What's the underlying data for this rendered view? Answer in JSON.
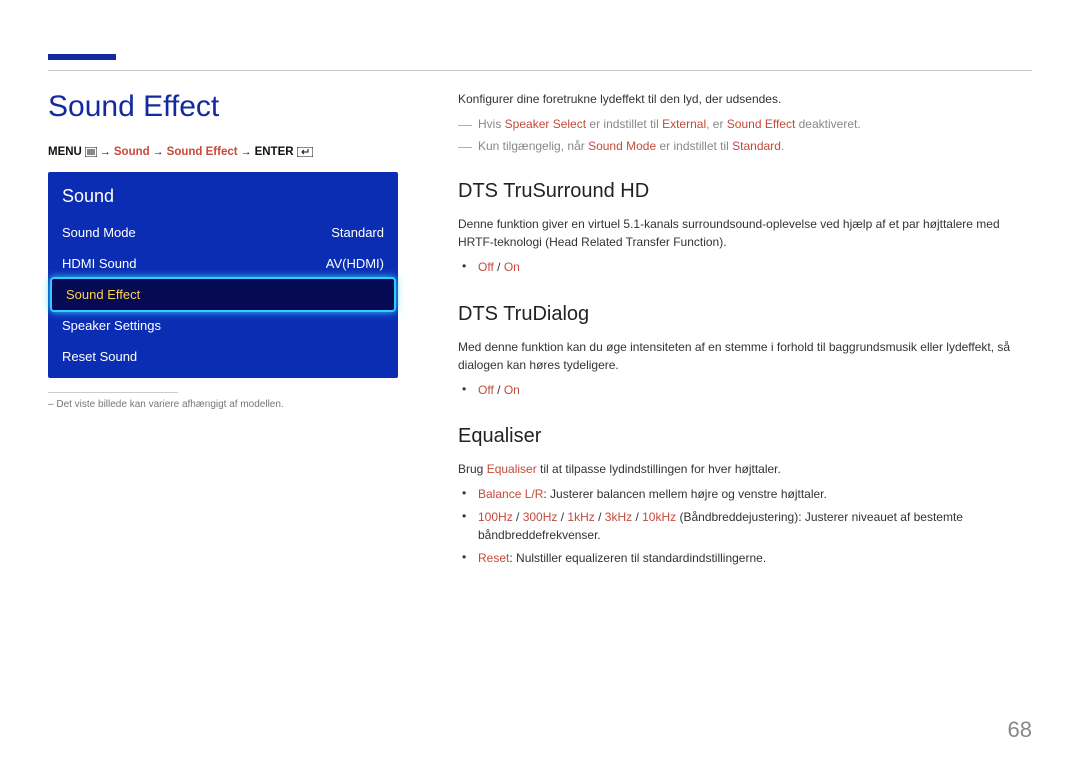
{
  "page_number": "68",
  "heading": "Sound Effect",
  "crumb": {
    "menu": "MENU",
    "s1": "Sound",
    "s2": "Sound Effect",
    "enter": "ENTER"
  },
  "menu": {
    "title": "Sound",
    "items": [
      {
        "label": "Sound Mode",
        "value": "Standard"
      },
      {
        "label": "HDMI Sound",
        "value": "AV(HDMI)"
      },
      {
        "label": "Sound Effect",
        "value": ""
      },
      {
        "label": "Speaker Settings",
        "value": ""
      },
      {
        "label": "Reset Sound",
        "value": ""
      }
    ],
    "selected_index": 2
  },
  "footnote": "Det viste billede kan variere afhængigt af modellen.",
  "intro": "Konfigurer dine foretrukne lydeffekt til den lyd, der udsendes.",
  "note1": {
    "pre": "Hvis ",
    "t1": "Speaker Select",
    "mid": " er indstillet til ",
    "t2": "External",
    "post": ", er ",
    "t3": "Sound Effect",
    "end": " deaktiveret."
  },
  "note2": {
    "pre": "Kun tilgængelig, når ",
    "t1": "Sound Mode",
    "mid": " er indstillet til ",
    "t2": "Standard",
    "end": "."
  },
  "sec1": {
    "title": "DTS TruSurround HD",
    "body": "Denne funktion giver en virtuel 5.1-kanals surroundsound-oplevelse ved hjælp af et par højttalere med HRTF-teknologi (Head Related Transfer Function).",
    "opt_off": "Off",
    "opt_sep": " / ",
    "opt_on": "On"
  },
  "sec2": {
    "title": "DTS TruDialog",
    "body": "Med denne funktion kan du øge intensiteten af en stemme i forhold til baggrundsmusik eller lydeffekt, så dialogen kan høres tydeligere.",
    "opt_off": "Off",
    "opt_sep": " / ",
    "opt_on": "On"
  },
  "sec3": {
    "title": "Equaliser",
    "lead_pre": "Brug ",
    "lead_t": "Equaliser",
    "lead_post": " til at tilpasse lydindstillingen for hver højttaler.",
    "b1_t": "Balance L/R",
    "b1_r": ": Justerer balancen mellem højre og venstre højttaler.",
    "b2_t1": "100Hz",
    "b2_t2": "300Hz",
    "b2_t3": "1kHz",
    "b2_t4": "3kHz",
    "b2_t5": "10kHz",
    "b2_sep": " / ",
    "b2_r": " (Båndbreddejustering): Justerer niveauet af bestemte båndbreddefrekvenser.",
    "b3_t": "Reset",
    "b3_r": ": Nulstiller equalizeren til standardindstillingerne."
  }
}
